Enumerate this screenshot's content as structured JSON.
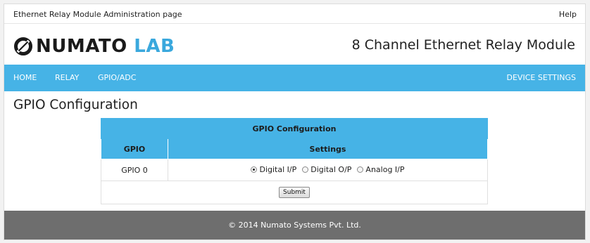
{
  "topbar": {
    "title": "Ethernet Relay Module Administration page",
    "help": "Help"
  },
  "brand": {
    "logo_word1": "NUMATO",
    "logo_word2": "LAB",
    "product": "8 Channel Ethernet Relay Module"
  },
  "colors": {
    "accent": "#46b3e6",
    "logo_blue": "#3aa8dd",
    "footer": "#6e6e6e"
  },
  "nav": {
    "home": "HOME",
    "relay": "RELAY",
    "gpio_adc": "GPIO/ADC",
    "device_settings": "DEVICE SETTINGS"
  },
  "page": {
    "heading": "GPIO Configuration"
  },
  "table": {
    "title": "GPIO Configuration",
    "col_gpio": "GPIO",
    "col_settings": "Settings",
    "rows": [
      {
        "gpio": "GPIO 0",
        "options": [
          {
            "label": "Digital I/P",
            "selected": true
          },
          {
            "label": "Digital O/P",
            "selected": false
          },
          {
            "label": "Analog I/P",
            "selected": false
          }
        ]
      }
    ],
    "submit": "Submit"
  },
  "footer": {
    "copyright": "© 2014 Numato Systems Pvt. Ltd."
  }
}
